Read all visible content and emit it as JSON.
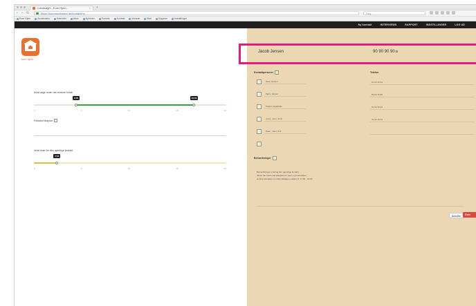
{
  "browser": {
    "tab_title": "Lokalsøgni - Kom Hjem...",
    "tab_close": "×",
    "new_tab": "+",
    "url": "https://kommunikation.dk/kontakt/ny",
    "search_placeholder": "Søg",
    "bookmarks": [
      "Kom Hjem",
      "Bookmarks",
      "Kalender",
      "Arkiv",
      "Nyheder",
      "Forside",
      "Kontakt",
      "Intranet",
      "Mail",
      "Opgaver",
      "Indstillinger"
    ]
  },
  "topnav": {
    "items": [
      "Ny kontakt",
      "INTERVIEWS",
      "RAPPORT",
      "INDSTILLINGER",
      "LOG UD"
    ]
  },
  "logo": {
    "text": "kom hjem"
  },
  "sliders": {
    "s1": {
      "label": "Antal dage under det ventede forløb",
      "min_bubble": "8:00",
      "max_bubble": "16:00",
      "min_fraction": 0.22,
      "max_fraction": 0.83,
      "ticks": [
        "0",
        "5",
        "10",
        "15",
        "20"
      ]
    },
    "s2": {
      "label": "Antal timer for den ugentlige kontakt",
      "bubble": "2:00",
      "fraction": 0.12,
      "ticks": [
        "0",
        "5",
        "10",
        "15",
        "20"
      ]
    },
    "checkbox_label": "Fleksibel tidsplan"
  },
  "form": {
    "name": "Jacob Jensen",
    "phone": "90 90 90 90",
    "section_left": "Kontaktpersoner",
    "section_right": "Telefon",
    "left_fields": [
      "Navn Jensen",
      "Marie Jensen",
      "Telefon ægtefælle",
      "Anna - barn, 11 år",
      "Peter - barn, 6 år",
      ""
    ],
    "right_fields": [
      "21 22 23 24",
      "50 60 70 80",
      "31 32 33 34",
      "41 42 43 44",
      ""
    ],
    "remarks_title": "Bemærkninger",
    "notes": [
      "Bemærkninger omkring den ugentlige kontakt",
      "Jacob har travlt med arbejdet om ugen og foretrækker",
      "at blive kontaktet om eftermiddagen mellem kl. 17:00 - 19:00"
    ],
    "cancel": "Annuller",
    "save": "Gem"
  }
}
